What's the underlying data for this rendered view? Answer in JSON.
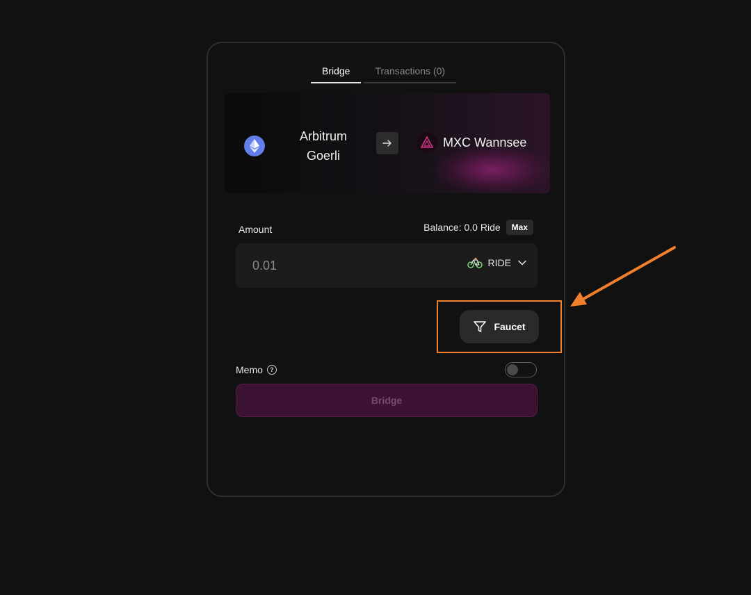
{
  "tabs": [
    {
      "label": "Bridge",
      "active": true
    },
    {
      "label": "Transactions (0)",
      "active": false
    }
  ],
  "chains": {
    "from": {
      "name": "Arbitrum Goerli",
      "icon": "ethereum-icon"
    },
    "swap_icon": "arrow-right-icon",
    "to": {
      "name": "MXC Wannsee",
      "icon": "mxc-icon"
    }
  },
  "amount": {
    "label": "Amount",
    "balance_text": "Balance: 0.0 Ride",
    "max_label": "Max",
    "placeholder": "0.01",
    "token": {
      "label": "RIDE",
      "icon": "bike-icon"
    },
    "dropdown_icon": "chevron-down-icon"
  },
  "faucet": {
    "label": "Faucet",
    "icon": "funnel-icon"
  },
  "memo": {
    "label": "Memo",
    "help_icon": "question-circle-icon",
    "enabled": false
  },
  "bridge_button": {
    "label": "Bridge",
    "disabled": true
  },
  "annotation": {
    "color": "#f07f2e"
  },
  "colors": {
    "background": "#111111",
    "bridge_button": "#3b1232",
    "ethereum": "#627eea",
    "mxc_accent": "#d6348a"
  }
}
